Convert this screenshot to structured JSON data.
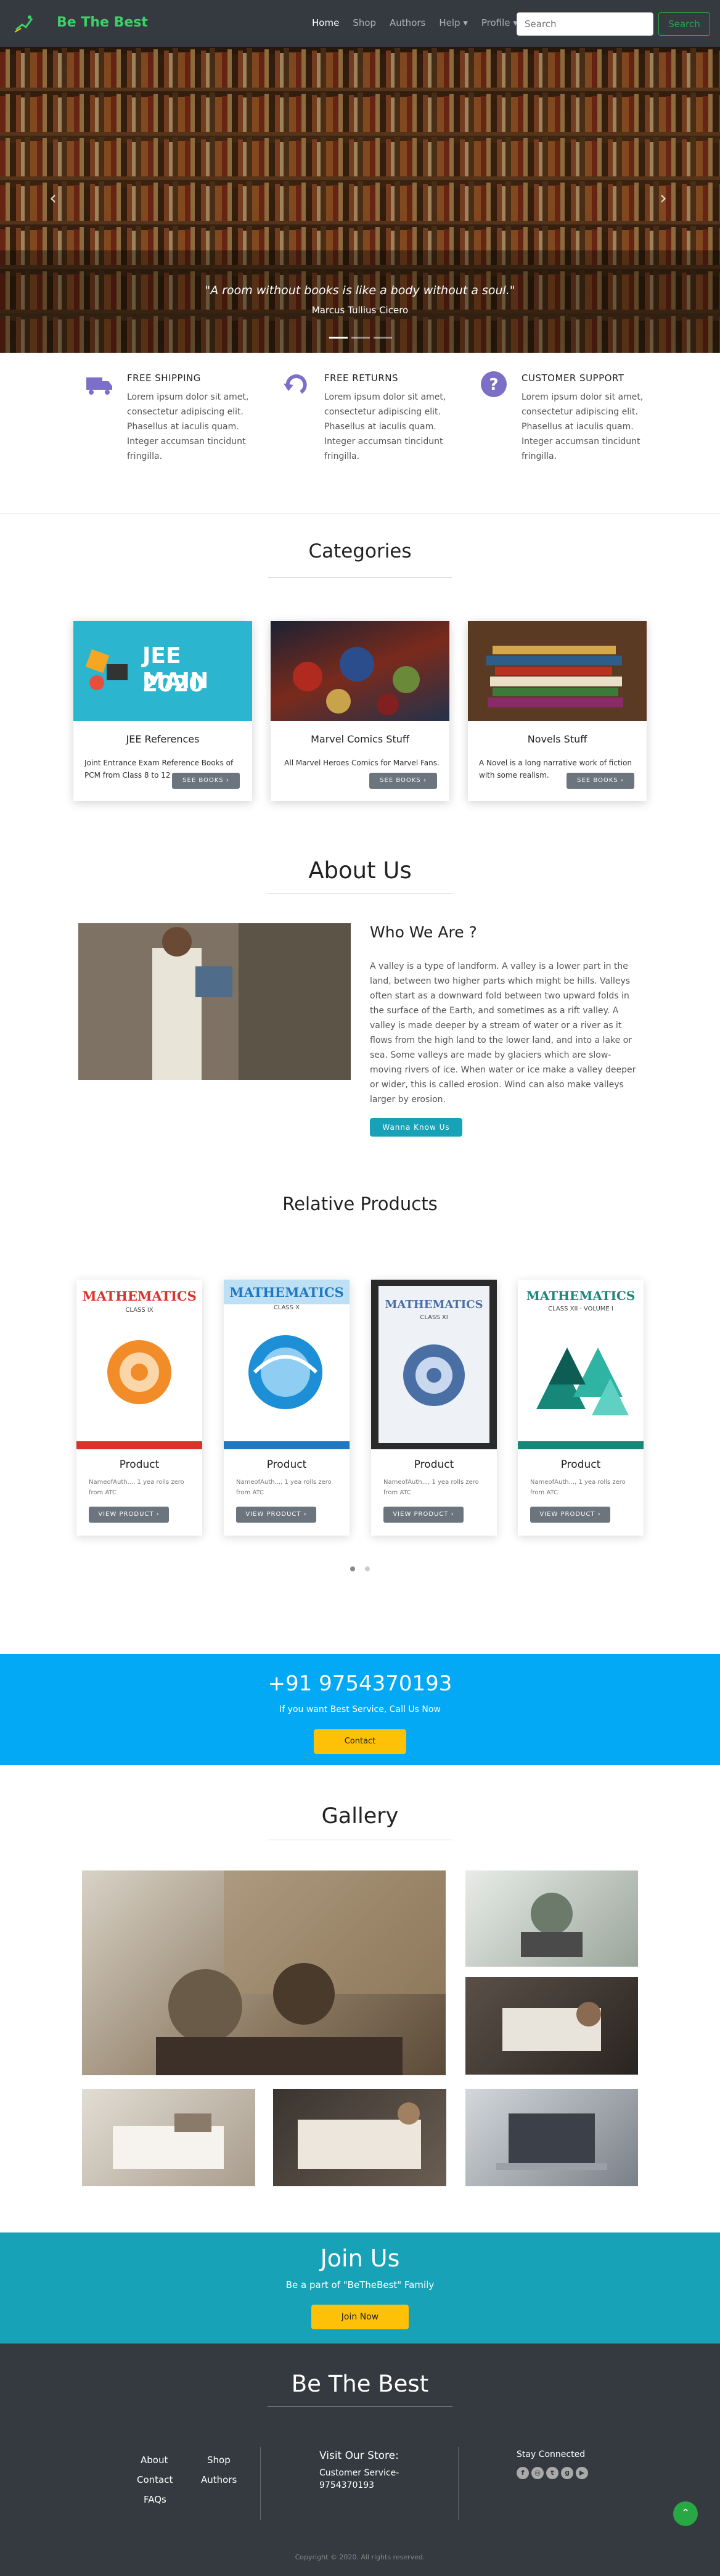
{
  "navbar": {
    "brand": "Be The Best",
    "links": [
      "Home",
      "Shop",
      "Authors",
      "Help ▾",
      "Profile ▾"
    ],
    "active_link": "Home",
    "search_placeholder": "Search",
    "search_button": "Search"
  },
  "hero": {
    "quote": "\"A room without books is like a body without a soul.\"",
    "author": "Marcus Tullius Cicero",
    "prev": "‹",
    "next": "›"
  },
  "features": [
    {
      "title": "FREE SHIPPING",
      "text": "Lorem ipsum dolor sit amet, consectetur adipiscing elit. Phasellus at iaculis quam. Integer accumsan tincidunt fringilla.",
      "icon": "truck-icon"
    },
    {
      "title": "FREE RETURNS",
      "text": "Lorem ipsum dolor sit amet, consectetur adipiscing elit. Phasellus at iaculis quam. Integer accumsan tincidunt fringilla.",
      "icon": "return-arrow-icon"
    },
    {
      "title": "CUSTOMER SUPPORT",
      "text": "Lorem ipsum dolor sit amet, consectetur adipiscing elit. Phasellus at iaculis quam. Integer accumsan tincidunt fringilla.",
      "icon": "question-icon"
    }
  ],
  "categories": {
    "title": "Categories",
    "cards": [
      {
        "name": "JEE References",
        "text": "Joint Entrance Exam Reference Books of PCM from Class 8 to 12",
        "button": "SEE BOOKS ›",
        "banner_line1": "JEE MAIN",
        "banner_line2": "2020"
      },
      {
        "name": "Marvel Comics Stuff",
        "text": "All Marvel Heroes Comics for Marvel Fans.",
        "button": "SEE BOOKS ›"
      },
      {
        "name": "Novels Stuff",
        "text": "A Novel is a long narrative work of fiction with some realism.",
        "button": "SEE BOOKS ›"
      }
    ]
  },
  "about": {
    "title": "About Us",
    "heading": "Who We Are ?",
    "text": "A valley is a type of landform. A valley is a lower part in the land, between two higher parts which might be hills. Valleys often start as a downward fold between two upward folds in the surface of the Earth, and sometimes as a rift valley. A valley is made deeper by a stream of water or a river as it flows from the high land to the lower land, and into a lake or sea. Some valleys are made by glaciers which are slow-moving rivers of ice. When water or ice make a valley deeper or wider, this is called erosion. Wind can also make valleys larger by erosion.",
    "button": "Wanna Know Us"
  },
  "products": {
    "title": "Relative Products",
    "items": [
      {
        "name": "Product",
        "text": "NameofAuth..., 1 yea rolls zero from ATC",
        "button": "VIEW PRODUCT ›",
        "cover_title": "MATHEMATICS",
        "cover_sub": "CLASS IX",
        "color": "#d9342b"
      },
      {
        "name": "Product",
        "text": "NameofAuth..., 1 yea rolls zero from ATC",
        "button": "VIEW PRODUCT ›",
        "cover_title": "MATHEMATICS",
        "cover_sub": "CLASS X",
        "color": "#1f78c1"
      },
      {
        "name": "Product",
        "text": "NameofAuth..., 1 yea rolls zero from ATC",
        "button": "VIEW PRODUCT ›",
        "cover_title": "MATHEMATICS",
        "cover_sub": "CLASS XI",
        "color": "#4a6fa5"
      },
      {
        "name": "Product",
        "text": "NameofAuth..., 1 yea rolls zero from ATC",
        "button": "VIEW PRODUCT ›",
        "cover_title": "MATHEMATICS",
        "cover_sub": "CLASS XII · VOLUME I",
        "color": "#17877a"
      }
    ]
  },
  "call": {
    "phone": "+91 9754370193",
    "text": "If you want Best Service, Call Us Now",
    "button": "Contact"
  },
  "gallery": {
    "title": "Gallery"
  },
  "join": {
    "title": "Join Us",
    "text": "Be a part of \"BeTheBest\" Family",
    "button": "Join Now"
  },
  "footer": {
    "title": "Be The Best",
    "links_col1": [
      "About",
      "Contact",
      "FAQs"
    ],
    "links_col2": [
      "Shop",
      "Authors"
    ],
    "store_title": "Visit Our Store:",
    "store_service": "Customer Service-",
    "store_phone": "9754370193",
    "stay_connected": "Stay Connected",
    "social_icons": [
      "facebook-icon",
      "instagram-icon",
      "twitter-icon",
      "google-plus-icon",
      "youtube-icon"
    ],
    "copyright": "Copyright © 2020. All rights reserved."
  },
  "colors": {
    "brand": "#3ecf6a",
    "navbar": "#343a40",
    "call_bg": "#03a9f4",
    "join_bg": "#17a2b8",
    "button_yellow": "#ffc107",
    "button_gray": "#6c757d"
  }
}
